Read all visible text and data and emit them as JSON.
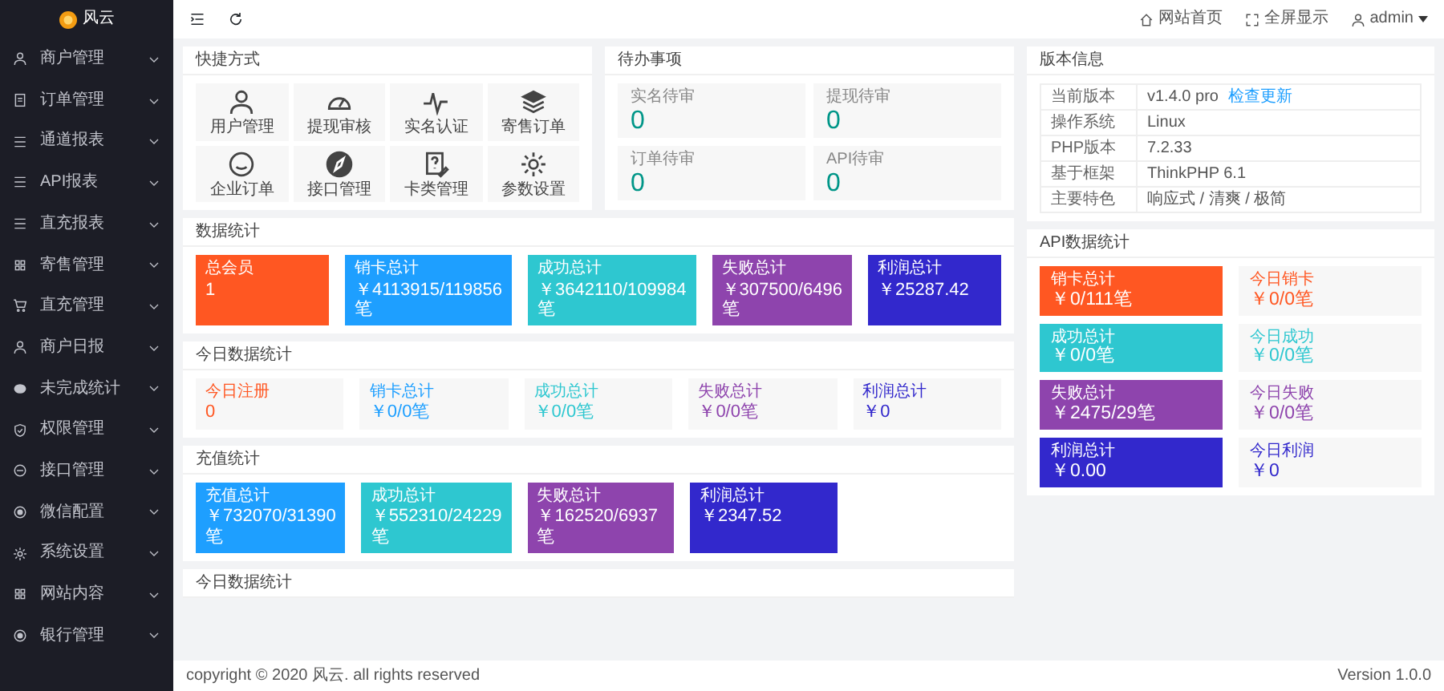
{
  "brand": {
    "name": "风云"
  },
  "sidebar": {
    "items": [
      {
        "label": "商户管理"
      },
      {
        "label": "订单管理"
      },
      {
        "label": "通道报表"
      },
      {
        "label": "API报表"
      },
      {
        "label": "直充报表"
      },
      {
        "label": "寄售管理"
      },
      {
        "label": "直充管理"
      },
      {
        "label": "商户日报"
      },
      {
        "label": "未完成统计"
      },
      {
        "label": "权限管理"
      },
      {
        "label": "接口管理"
      },
      {
        "label": "微信配置"
      },
      {
        "label": "系统设置"
      },
      {
        "label": "网站内容"
      },
      {
        "label": "银行管理"
      }
    ]
  },
  "header": {
    "links": [
      {
        "label": "网站首页"
      },
      {
        "label": "全屏显示"
      },
      {
        "label": "admin"
      }
    ]
  },
  "shortcuts": {
    "title": "快捷方式",
    "items": [
      {
        "label": "用户管理"
      },
      {
        "label": "提现审核"
      },
      {
        "label": "实名认证"
      },
      {
        "label": "寄售订单"
      },
      {
        "label": "企业订单"
      },
      {
        "label": "接口管理"
      },
      {
        "label": "卡类管理"
      },
      {
        "label": "参数设置"
      }
    ]
  },
  "pending": {
    "title": "待办事项",
    "items": [
      {
        "label": "实名待审",
        "value": "0"
      },
      {
        "label": "提现待审",
        "value": "0"
      },
      {
        "label": "订单待审",
        "value": "0"
      },
      {
        "label": "API待审",
        "value": "0"
      }
    ]
  },
  "version": {
    "title": "版本信息",
    "rows": [
      {
        "label": "当前版本",
        "value": "v1.4.0 pro",
        "link": "检查更新"
      },
      {
        "label": "操作系统",
        "value": "Linux"
      },
      {
        "label": "PHP版本",
        "value": "7.2.33"
      },
      {
        "label": "基于框架",
        "value": "ThinkPHP 6.1"
      },
      {
        "label": "主要特色",
        "value": "响应式 / 清爽 / 极简"
      }
    ]
  },
  "sections": [
    {
      "title": "数据统计",
      "kind": "solid",
      "items": [
        {
          "label": "总会员",
          "value": "1",
          "color": "#ff5722"
        },
        {
          "label": "销卡总计",
          "value": "￥4113915/119856笔",
          "color": "#1e9fff"
        },
        {
          "label": "成功总计",
          "value": "￥3642110/109984笔",
          "color": "#2ec7d0"
        },
        {
          "label": "失败总计",
          "value": "￥307500/6496笔",
          "color": "#8e44ad"
        },
        {
          "label": "利润总计",
          "value": "￥25287.42",
          "color": "#3228cc"
        }
      ]
    },
    {
      "title": "今日数据统计",
      "kind": "light",
      "items": [
        {
          "label": "今日注册",
          "value": "0",
          "color": "#ff5722"
        },
        {
          "label": "销卡总计",
          "value": "￥0/0笔",
          "color": "#1e9fff"
        },
        {
          "label": "成功总计",
          "value": "￥0/0笔",
          "color": "#2ec7d0"
        },
        {
          "label": "失败总计",
          "value": "￥0/0笔",
          "color": "#8e44ad"
        },
        {
          "label": "利润总计",
          "value": "￥0",
          "color": "#3228cc"
        }
      ]
    },
    {
      "title": "充值统计",
      "kind": "solid",
      "items": [
        {
          "label": "充值总计",
          "value": "￥732070/31390笔",
          "color": "#1e9fff"
        },
        {
          "label": "成功总计",
          "value": "￥552310/24229笔",
          "color": "#2ec7d0"
        },
        {
          "label": "失败总计",
          "value": "￥162520/6937笔",
          "color": "#8e44ad"
        },
        {
          "label": "利润总计",
          "value": "￥2347.52",
          "color": "#3228cc"
        }
      ]
    },
    {
      "title": "今日数据统计",
      "kind": "none"
    }
  ],
  "api_stats": {
    "title": "API数据统计",
    "rows": [
      {
        "total": {
          "label": "销卡总计",
          "value": "￥0/111笔"
        },
        "today": {
          "label": "今日销卡",
          "value": "￥0/0笔"
        },
        "color": "#ff5722"
      },
      {
        "total": {
          "label": "成功总计",
          "value": "￥0/0笔"
        },
        "today": {
          "label": "今日成功",
          "value": "￥0/0笔"
        },
        "color": "#2ec7d0"
      },
      {
        "total": {
          "label": "失败总计",
          "value": "￥2475/29笔"
        },
        "today": {
          "label": "今日失败",
          "value": "￥0/0笔"
        },
        "color": "#8e44ad"
      },
      {
        "total": {
          "label": "利润总计",
          "value": "￥0.00"
        },
        "today": {
          "label": "今日利润",
          "value": "￥0"
        },
        "color": "#3228cc"
      }
    ]
  },
  "footer": {
    "copyright": "copyright © 2020 风云. all rights reserved",
    "version": "Version 1.0.0"
  }
}
